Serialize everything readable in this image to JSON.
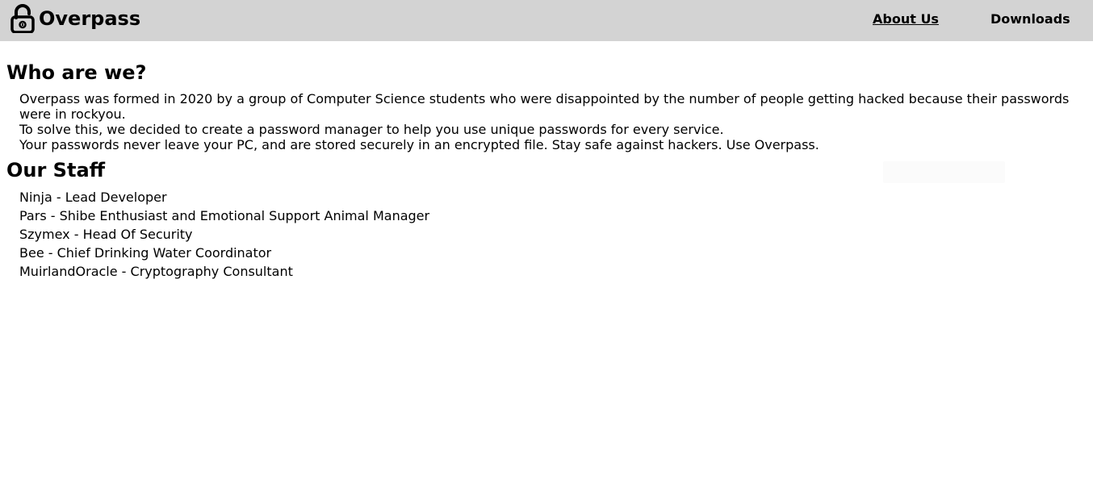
{
  "navbar": {
    "brand": {
      "icon": "padlock-icon",
      "name": "Overpass"
    },
    "links": [
      {
        "label": "About Us"
      },
      {
        "label": "Downloads"
      }
    ],
    "background": "#d3d3d3"
  },
  "main": {
    "who_heading": "Who are we?",
    "about_paragraphs": [
      "Overpass was formed in 2020 by a group of Computer Science students who were disappointed by the number of people getting hacked because their passwords were in rockyou.",
      "To solve this, we decided to create a password manager to help you use unique passwords for every service.",
      "Your passwords never leave your PC, and are stored securely in an encrypted file. Stay safe against hackers. Use Overpass."
    ],
    "staff_heading": "Our Staff",
    "staff": [
      "Ninja - Lead Developer",
      "Pars - Shibe Enthusiast and Emotional Support Animal Manager",
      "Szymex - Head Of Security",
      "Bee - Chief Drinking Water Coordinator",
      "MuirlandOracle - Cryptography Consultant"
    ]
  }
}
